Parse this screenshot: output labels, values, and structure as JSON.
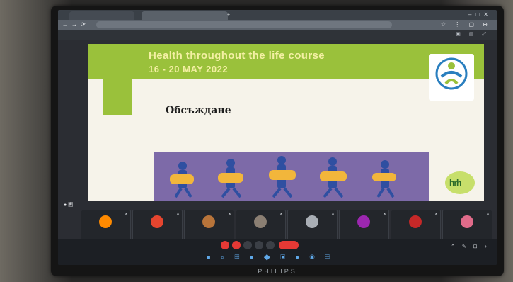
{
  "browser": {
    "tab_left": "",
    "tab_active": "",
    "url": ""
  },
  "zoom": {
    "meeting_title": "",
    "slide_label": "● 團"
  },
  "slide": {
    "title": "Health throughout the life course",
    "dates": "16 - 20 MAY 2022",
    "heading": "Обсъждане",
    "paragraph1": "",
    "paragraph2": "",
    "badge_text": "hrh"
  },
  "participants": [
    {
      "name": "",
      "color": "#ff8a00"
    },
    {
      "name": "",
      "color": "#e5452f"
    },
    {
      "name": "",
      "color": "#b8743a"
    },
    {
      "name": "",
      "color": "#8b7f73"
    },
    {
      "name": "",
      "color": "#a9aeb5"
    },
    {
      "name": "",
      "color": "#9c27b0"
    },
    {
      "name": "",
      "color": "#c62828"
    },
    {
      "name": "",
      "color": "#e06b8a"
    }
  ],
  "taskbar": {
    "left_status": "",
    "weather": "",
    "clock_time": "",
    "clock_date": ""
  },
  "monitor": {
    "brand": "PHILIPS"
  },
  "colors": {
    "slide_green": "#9ac13b",
    "banner_purple": "#7d6aa8",
    "zoom_bg": "#2b2d33"
  }
}
